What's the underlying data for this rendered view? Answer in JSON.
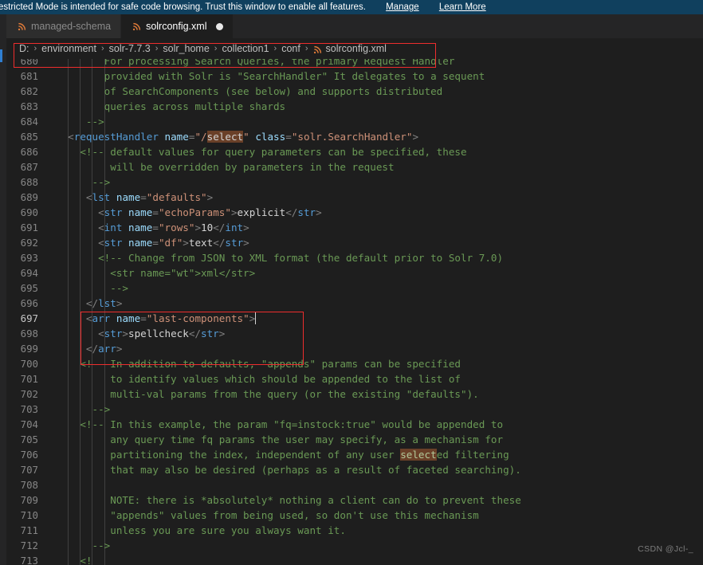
{
  "banner": {
    "message": "estricted Mode is intended for safe code browsing. Trust this window to enable all features.",
    "manage_label": "Manage",
    "learn_more_label": "Learn More",
    "background": "#10405e"
  },
  "tabs": [
    {
      "label": "managed-schema",
      "icon": "xml-file-icon",
      "active": false,
      "dirty": false
    },
    {
      "label": "solrconfig.xml",
      "icon": "xml-file-icon",
      "active": true,
      "dirty": true
    }
  ],
  "breadcrumb": {
    "separator": "›",
    "items": [
      "D:",
      "environment",
      "solr-7.7.3",
      "solr_home",
      "collection1",
      "conf"
    ],
    "file": "solrconfig.xml",
    "file_icon": "xml-file-icon"
  },
  "editor": {
    "language": "xml",
    "active_line": 697,
    "search_term": "select",
    "first_visible_line": 680,
    "last_visible_line": 713,
    "lines": [
      {
        "n": 680,
        "clipped": true,
        "tokens": [
          {
            "t": "comment",
            "s": "        For processing Search Queries, the primary Request Handler"
          }
        ]
      },
      {
        "n": 681,
        "tokens": [
          {
            "t": "comment",
            "s": "        provided with Solr is \"SearchHandler\" It delegates to a sequent"
          }
        ]
      },
      {
        "n": 682,
        "tokens": [
          {
            "t": "comment",
            "s": "        of SearchComponents (see below) and supports distributed"
          }
        ]
      },
      {
        "n": 683,
        "tokens": [
          {
            "t": "comment",
            "s": "        queries across multiple shards"
          }
        ]
      },
      {
        "n": 684,
        "tokens": [
          {
            "t": "comment",
            "s": "     -->"
          }
        ]
      },
      {
        "n": 685,
        "tokens": [
          {
            "t": "plain",
            "s": "  "
          },
          {
            "t": "punc",
            "s": "<"
          },
          {
            "t": "tag",
            "s": "requestHandler"
          },
          {
            "t": "plain",
            "s": " "
          },
          {
            "t": "attr",
            "s": "name"
          },
          {
            "t": "punc",
            "s": "="
          },
          {
            "t": "str",
            "s": "\"/"
          },
          {
            "t": "hl",
            "s": "select"
          },
          {
            "t": "str",
            "s": "\""
          },
          {
            "t": "plain",
            "s": " "
          },
          {
            "t": "attr",
            "s": "class"
          },
          {
            "t": "punc",
            "s": "="
          },
          {
            "t": "str",
            "s": "\"solr.SearchHandler\""
          },
          {
            "t": "punc",
            "s": ">"
          }
        ]
      },
      {
        "n": 686,
        "tokens": [
          {
            "t": "comment",
            "s": "    <!-- default values for query parameters can be specified, these"
          }
        ]
      },
      {
        "n": 687,
        "tokens": [
          {
            "t": "comment",
            "s": "         will be overridden by parameters in the request"
          }
        ]
      },
      {
        "n": 688,
        "tokens": [
          {
            "t": "comment",
            "s": "      -->"
          }
        ]
      },
      {
        "n": 689,
        "tokens": [
          {
            "t": "plain",
            "s": "     "
          },
          {
            "t": "punc",
            "s": "<"
          },
          {
            "t": "tag",
            "s": "lst"
          },
          {
            "t": "plain",
            "s": " "
          },
          {
            "t": "attr",
            "s": "name"
          },
          {
            "t": "punc",
            "s": "="
          },
          {
            "t": "str",
            "s": "\"defaults\""
          },
          {
            "t": "punc",
            "s": ">"
          }
        ]
      },
      {
        "n": 690,
        "tokens": [
          {
            "t": "plain",
            "s": "       "
          },
          {
            "t": "punc",
            "s": "<"
          },
          {
            "t": "tag",
            "s": "str"
          },
          {
            "t": "plain",
            "s": " "
          },
          {
            "t": "attr",
            "s": "name"
          },
          {
            "t": "punc",
            "s": "="
          },
          {
            "t": "str",
            "s": "\"echoParams\""
          },
          {
            "t": "punc",
            "s": ">"
          },
          {
            "t": "txt",
            "s": "explicit"
          },
          {
            "t": "punc",
            "s": "</"
          },
          {
            "t": "tag",
            "s": "str"
          },
          {
            "t": "punc",
            "s": ">"
          }
        ]
      },
      {
        "n": 691,
        "tokens": [
          {
            "t": "plain",
            "s": "       "
          },
          {
            "t": "punc",
            "s": "<"
          },
          {
            "t": "tag",
            "s": "int"
          },
          {
            "t": "plain",
            "s": " "
          },
          {
            "t": "attr",
            "s": "name"
          },
          {
            "t": "punc",
            "s": "="
          },
          {
            "t": "str",
            "s": "\"rows\""
          },
          {
            "t": "punc",
            "s": ">"
          },
          {
            "t": "txt",
            "s": "10"
          },
          {
            "t": "punc",
            "s": "</"
          },
          {
            "t": "tag",
            "s": "int"
          },
          {
            "t": "punc",
            "s": ">"
          }
        ]
      },
      {
        "n": 692,
        "tokens": [
          {
            "t": "plain",
            "s": "       "
          },
          {
            "t": "punc",
            "s": "<"
          },
          {
            "t": "tag",
            "s": "str"
          },
          {
            "t": "plain",
            "s": " "
          },
          {
            "t": "attr",
            "s": "name"
          },
          {
            "t": "punc",
            "s": "="
          },
          {
            "t": "str",
            "s": "\"df\""
          },
          {
            "t": "punc",
            "s": ">"
          },
          {
            "t": "txt",
            "s": "text"
          },
          {
            "t": "punc",
            "s": "</"
          },
          {
            "t": "tag",
            "s": "str"
          },
          {
            "t": "punc",
            "s": ">"
          }
        ]
      },
      {
        "n": 693,
        "tokens": [
          {
            "t": "comment",
            "s": "       <!-- Change from JSON to XML format (the default prior to Solr 7.0)"
          }
        ]
      },
      {
        "n": 694,
        "tokens": [
          {
            "t": "comment",
            "s": "         <str name=\"wt\">xml</str>"
          }
        ]
      },
      {
        "n": 695,
        "tokens": [
          {
            "t": "comment",
            "s": "         -->"
          }
        ]
      },
      {
        "n": 696,
        "tokens": [
          {
            "t": "plain",
            "s": "     "
          },
          {
            "t": "punc",
            "s": "</"
          },
          {
            "t": "tag",
            "s": "lst"
          },
          {
            "t": "punc",
            "s": ">"
          }
        ]
      },
      {
        "n": 697,
        "active": true,
        "tokens": [
          {
            "t": "plain",
            "s": "     "
          },
          {
            "t": "punc",
            "s": "<"
          },
          {
            "t": "tag",
            "s": "arr"
          },
          {
            "t": "plain",
            "s": " "
          },
          {
            "t": "attr",
            "s": "name"
          },
          {
            "t": "punc",
            "s": "="
          },
          {
            "t": "str",
            "s": "\"last-components\""
          },
          {
            "t": "punc",
            "s": ">"
          },
          {
            "t": "cursor",
            "s": ""
          }
        ]
      },
      {
        "n": 698,
        "tokens": [
          {
            "t": "plain",
            "s": "       "
          },
          {
            "t": "punc",
            "s": "<"
          },
          {
            "t": "tag",
            "s": "str"
          },
          {
            "t": "punc",
            "s": ">"
          },
          {
            "t": "txt",
            "s": "spellcheck"
          },
          {
            "t": "punc",
            "s": "</"
          },
          {
            "t": "tag",
            "s": "str"
          },
          {
            "t": "punc",
            "s": ">"
          }
        ]
      },
      {
        "n": 699,
        "tokens": [
          {
            "t": "plain",
            "s": "     "
          },
          {
            "t": "punc",
            "s": "</"
          },
          {
            "t": "tag",
            "s": "arr"
          },
          {
            "t": "punc",
            "s": ">"
          }
        ]
      },
      {
        "n": 700,
        "tokens": [
          {
            "t": "comment",
            "s": "    <!-- In addition to defaults, \"appends\" params can be specified"
          }
        ]
      },
      {
        "n": 701,
        "tokens": [
          {
            "t": "comment",
            "s": "         to identify values which should be appended to the list of"
          }
        ]
      },
      {
        "n": 702,
        "tokens": [
          {
            "t": "comment",
            "s": "         multi-val params from the query (or the existing \"defaults\")."
          }
        ]
      },
      {
        "n": 703,
        "tokens": [
          {
            "t": "comment",
            "s": "      -->"
          }
        ]
      },
      {
        "n": 704,
        "tokens": [
          {
            "t": "comment",
            "s": "    <!-- In this example, the param \"fq=instock:true\" would be appended to"
          }
        ]
      },
      {
        "n": 705,
        "tokens": [
          {
            "t": "comment",
            "s": "         any query time fq params the user may specify, as a mechanism for"
          }
        ]
      },
      {
        "n": 706,
        "tokens": [
          {
            "t": "comment",
            "s": "         partitioning the index, independent of any user "
          },
          {
            "t": "hl-c",
            "s": "select"
          },
          {
            "t": "comment",
            "s": "ed filtering"
          }
        ]
      },
      {
        "n": 707,
        "tokens": [
          {
            "t": "comment",
            "s": "         that may also be desired (perhaps as a result of faceted searching)."
          }
        ]
      },
      {
        "n": 708,
        "tokens": [
          {
            "t": "plain",
            "s": ""
          }
        ]
      },
      {
        "n": 709,
        "tokens": [
          {
            "t": "comment",
            "s": "         NOTE: there is *absolutely* nothing a client can do to prevent these"
          }
        ]
      },
      {
        "n": 710,
        "tokens": [
          {
            "t": "comment",
            "s": "         \"appends\" values from being used, so don't use this mechanism"
          }
        ]
      },
      {
        "n": 711,
        "tokens": [
          {
            "t": "comment",
            "s": "         unless you are sure you always want it."
          }
        ]
      },
      {
        "n": 712,
        "tokens": [
          {
            "t": "comment",
            "s": "      -->"
          }
        ]
      },
      {
        "n": 713,
        "tokens": [
          {
            "t": "comment",
            "s": "    <!"
          }
        ]
      }
    ],
    "indent_guide_columns": [
      2,
      4,
      6,
      8
    ],
    "colors": {
      "background": "#1e1e1e",
      "comment": "#6a9955",
      "tag": "#569cd6",
      "attribute": "#9cdcfe",
      "string": "#ce9178",
      "text": "#d4d4d4",
      "line_number": "#868686",
      "search_highlight": "#6a4028"
    }
  },
  "annotations": [
    {
      "name": "breadcrumb-highlight",
      "color": "#ee2d2d"
    },
    {
      "name": "code-block-highlight",
      "color": "#ee2d2d"
    }
  ],
  "watermark": {
    "text": "CSDN @Jcl-_"
  }
}
